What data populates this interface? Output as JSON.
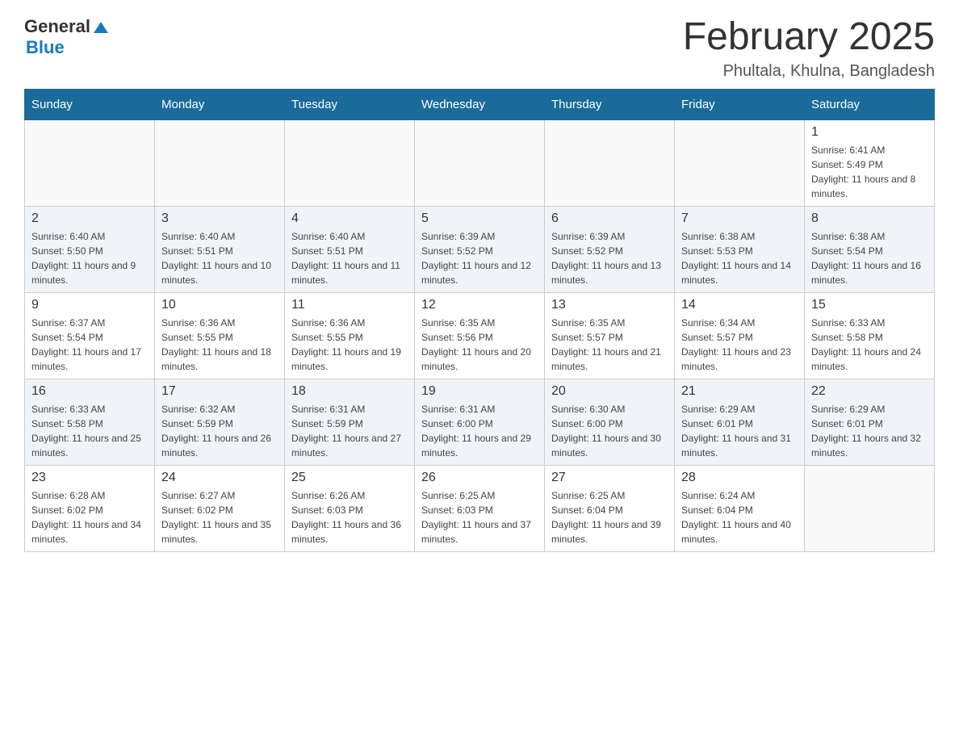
{
  "header": {
    "logo_general": "General",
    "logo_blue": "Blue",
    "month_title": "February 2025",
    "location": "Phultala, Khulna, Bangladesh"
  },
  "days_of_week": [
    "Sunday",
    "Monday",
    "Tuesday",
    "Wednesday",
    "Thursday",
    "Friday",
    "Saturday"
  ],
  "weeks": [
    [
      {
        "day": "",
        "info": ""
      },
      {
        "day": "",
        "info": ""
      },
      {
        "day": "",
        "info": ""
      },
      {
        "day": "",
        "info": ""
      },
      {
        "day": "",
        "info": ""
      },
      {
        "day": "",
        "info": ""
      },
      {
        "day": "1",
        "info": "Sunrise: 6:41 AM\nSunset: 5:49 PM\nDaylight: 11 hours and 8 minutes."
      }
    ],
    [
      {
        "day": "2",
        "info": "Sunrise: 6:40 AM\nSunset: 5:50 PM\nDaylight: 11 hours and 9 minutes."
      },
      {
        "day": "3",
        "info": "Sunrise: 6:40 AM\nSunset: 5:51 PM\nDaylight: 11 hours and 10 minutes."
      },
      {
        "day": "4",
        "info": "Sunrise: 6:40 AM\nSunset: 5:51 PM\nDaylight: 11 hours and 11 minutes."
      },
      {
        "day": "5",
        "info": "Sunrise: 6:39 AM\nSunset: 5:52 PM\nDaylight: 11 hours and 12 minutes."
      },
      {
        "day": "6",
        "info": "Sunrise: 6:39 AM\nSunset: 5:52 PM\nDaylight: 11 hours and 13 minutes."
      },
      {
        "day": "7",
        "info": "Sunrise: 6:38 AM\nSunset: 5:53 PM\nDaylight: 11 hours and 14 minutes."
      },
      {
        "day": "8",
        "info": "Sunrise: 6:38 AM\nSunset: 5:54 PM\nDaylight: 11 hours and 16 minutes."
      }
    ],
    [
      {
        "day": "9",
        "info": "Sunrise: 6:37 AM\nSunset: 5:54 PM\nDaylight: 11 hours and 17 minutes."
      },
      {
        "day": "10",
        "info": "Sunrise: 6:36 AM\nSunset: 5:55 PM\nDaylight: 11 hours and 18 minutes."
      },
      {
        "day": "11",
        "info": "Sunrise: 6:36 AM\nSunset: 5:55 PM\nDaylight: 11 hours and 19 minutes."
      },
      {
        "day": "12",
        "info": "Sunrise: 6:35 AM\nSunset: 5:56 PM\nDaylight: 11 hours and 20 minutes."
      },
      {
        "day": "13",
        "info": "Sunrise: 6:35 AM\nSunset: 5:57 PM\nDaylight: 11 hours and 21 minutes."
      },
      {
        "day": "14",
        "info": "Sunrise: 6:34 AM\nSunset: 5:57 PM\nDaylight: 11 hours and 23 minutes."
      },
      {
        "day": "15",
        "info": "Sunrise: 6:33 AM\nSunset: 5:58 PM\nDaylight: 11 hours and 24 minutes."
      }
    ],
    [
      {
        "day": "16",
        "info": "Sunrise: 6:33 AM\nSunset: 5:58 PM\nDaylight: 11 hours and 25 minutes."
      },
      {
        "day": "17",
        "info": "Sunrise: 6:32 AM\nSunset: 5:59 PM\nDaylight: 11 hours and 26 minutes."
      },
      {
        "day": "18",
        "info": "Sunrise: 6:31 AM\nSunset: 5:59 PM\nDaylight: 11 hours and 27 minutes."
      },
      {
        "day": "19",
        "info": "Sunrise: 6:31 AM\nSunset: 6:00 PM\nDaylight: 11 hours and 29 minutes."
      },
      {
        "day": "20",
        "info": "Sunrise: 6:30 AM\nSunset: 6:00 PM\nDaylight: 11 hours and 30 minutes."
      },
      {
        "day": "21",
        "info": "Sunrise: 6:29 AM\nSunset: 6:01 PM\nDaylight: 11 hours and 31 minutes."
      },
      {
        "day": "22",
        "info": "Sunrise: 6:29 AM\nSunset: 6:01 PM\nDaylight: 11 hours and 32 minutes."
      }
    ],
    [
      {
        "day": "23",
        "info": "Sunrise: 6:28 AM\nSunset: 6:02 PM\nDaylight: 11 hours and 34 minutes."
      },
      {
        "day": "24",
        "info": "Sunrise: 6:27 AM\nSunset: 6:02 PM\nDaylight: 11 hours and 35 minutes."
      },
      {
        "day": "25",
        "info": "Sunrise: 6:26 AM\nSunset: 6:03 PM\nDaylight: 11 hours and 36 minutes."
      },
      {
        "day": "26",
        "info": "Sunrise: 6:25 AM\nSunset: 6:03 PM\nDaylight: 11 hours and 37 minutes."
      },
      {
        "day": "27",
        "info": "Sunrise: 6:25 AM\nSunset: 6:04 PM\nDaylight: 11 hours and 39 minutes."
      },
      {
        "day": "28",
        "info": "Sunrise: 6:24 AM\nSunset: 6:04 PM\nDaylight: 11 hours and 40 minutes."
      },
      {
        "day": "",
        "info": ""
      }
    ]
  ]
}
